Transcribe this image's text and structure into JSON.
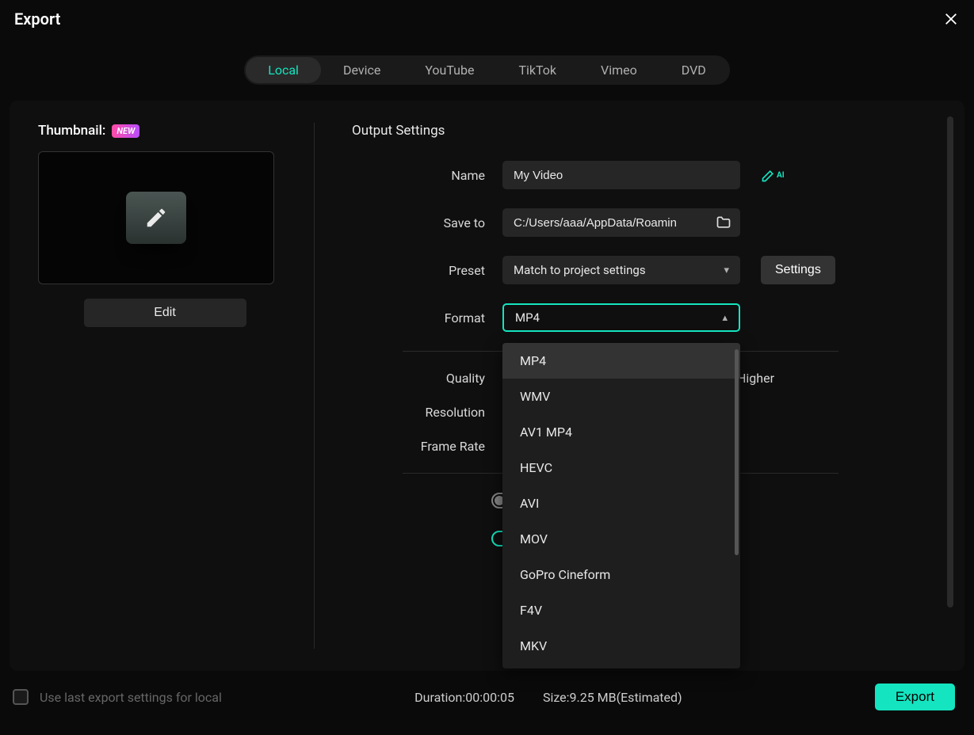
{
  "window": {
    "title": "Export"
  },
  "tabs": [
    "Local",
    "Device",
    "YouTube",
    "TikTok",
    "Vimeo",
    "DVD"
  ],
  "active_tab": 0,
  "thumbnail": {
    "label": "Thumbnail:",
    "badge": "NEW",
    "edit": "Edit"
  },
  "output": {
    "section_title": "Output Settings",
    "name_label": "Name",
    "name_value": "My Video",
    "saveto_label": "Save to",
    "saveto_value": "C:/Users/aaa/AppData/Roamin",
    "preset_label": "Preset",
    "preset_value": "Match to project settings",
    "settings_btn": "Settings",
    "format_label": "Format",
    "format_value": "MP4",
    "format_options": [
      "MP4",
      "WMV",
      "AV1 MP4",
      "HEVC",
      "AVI",
      "MOV",
      "GoPro Cineform",
      "F4V",
      "MKV"
    ],
    "quality_label": "Quality",
    "quality_higher": "Higher",
    "resolution_label": "Resolution",
    "framerate_label": "Frame Rate"
  },
  "footer": {
    "uselast": "Use last export settings for local",
    "duration_label": "Duration:",
    "duration_value": "00:00:05",
    "size_label": "Size:",
    "size_value": "9.25 MB",
    "estimated": "(Estimated)",
    "export_btn": "Export"
  }
}
